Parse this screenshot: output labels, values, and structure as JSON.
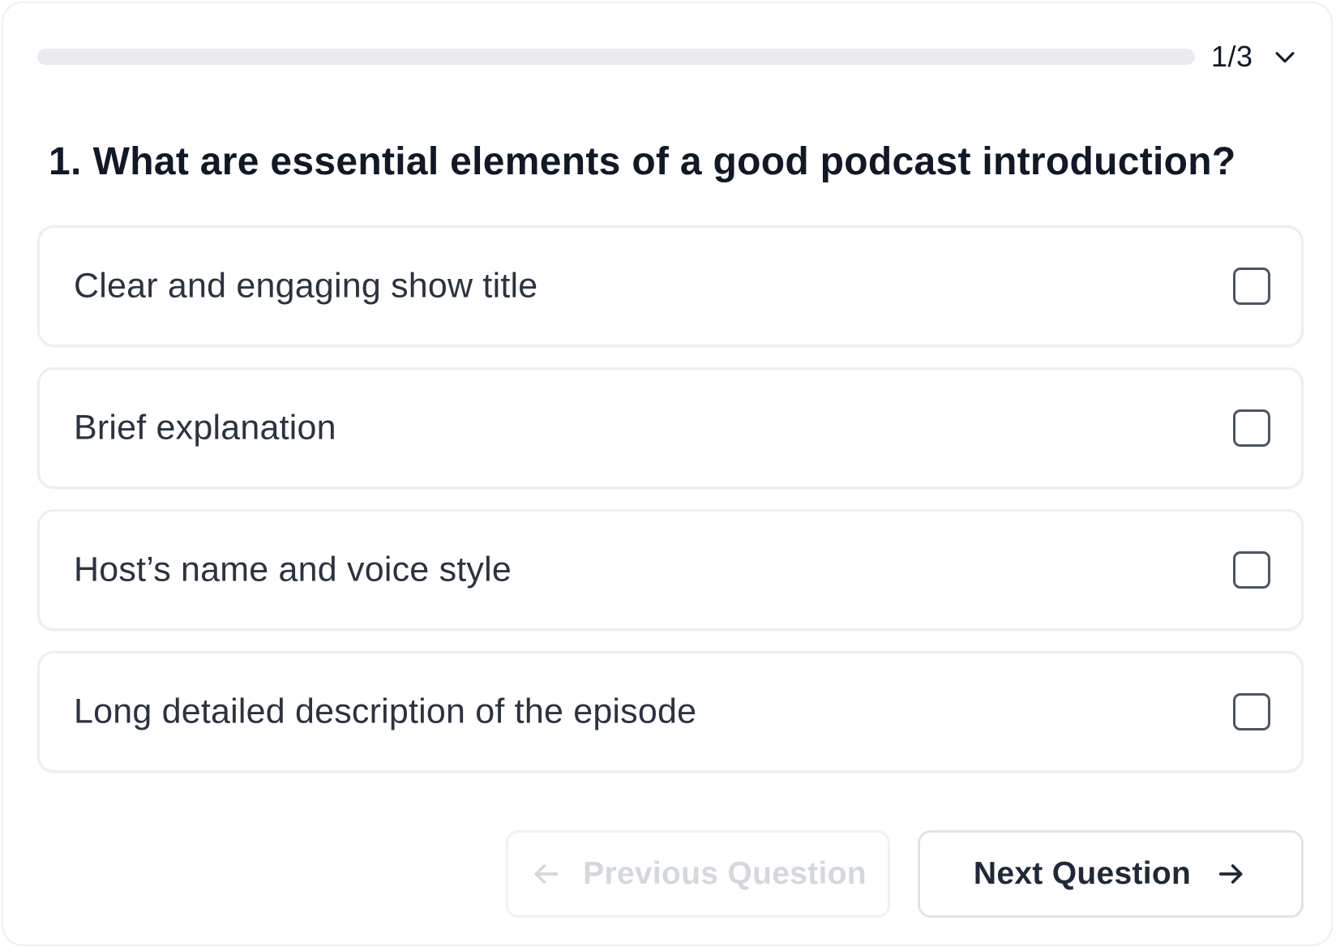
{
  "progress": {
    "fraction": 0,
    "counter": "1/3"
  },
  "question": {
    "number": "1.",
    "text": "What are essential elements of a good podcast introduction?"
  },
  "options": [
    {
      "label": "Clear and engaging show title",
      "checked": false
    },
    {
      "label": "Brief explanation",
      "checked": false
    },
    {
      "label": "Host’s name and voice style",
      "checked": false
    },
    {
      "label": "Long detailed description of the episode",
      "checked": false
    }
  ],
  "navigation": {
    "previous_label": "Previous Question",
    "previous_disabled": true,
    "next_label": "Next Question"
  },
  "icons": {
    "counter_toggle": "chevron-down-icon",
    "previous": "arrow-left-icon",
    "next": "arrow-right-icon"
  },
  "colors": {
    "disabled_text": "#d4d8dd",
    "text": "#1f2937",
    "border": "#eceef1"
  }
}
